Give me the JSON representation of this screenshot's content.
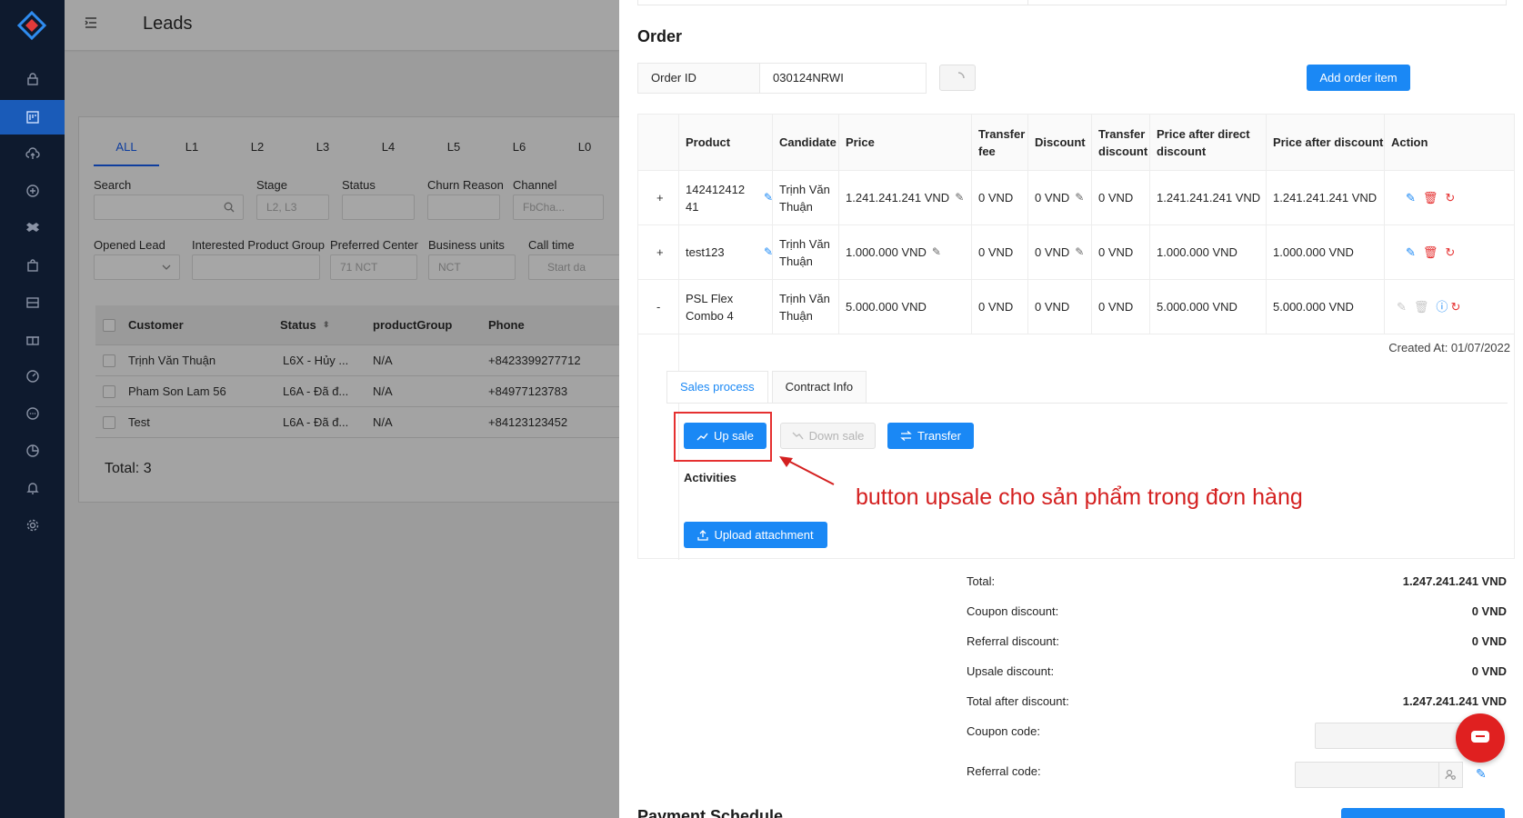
{
  "app": {
    "page_title": "Leads",
    "nav_icons": [
      "lock-icon",
      "board-icon",
      "upload-cloud-icon",
      "plus-circle-icon",
      "dropbox-icon",
      "bag-icon",
      "storage-icon",
      "gift-icon",
      "dashboard-icon",
      "chat-icon",
      "pie-chart-icon",
      "bell-icon",
      "gear-icon"
    ],
    "nav_active_index": 1
  },
  "leads": {
    "tabs": [
      "ALL",
      "L1",
      "L2",
      "L3",
      "L4",
      "L5",
      "L6",
      "L0"
    ],
    "active_tab": "ALL",
    "filters_row1": [
      {
        "label": "Search",
        "placeholder": ""
      },
      {
        "label": "Stage",
        "placeholder": "L2, L3"
      },
      {
        "label": "Status",
        "placeholder": ""
      },
      {
        "label": "Churn Reason",
        "placeholder": ""
      },
      {
        "label": "Channel",
        "placeholder": "FbCha..."
      }
    ],
    "filters_row2": [
      {
        "label": "Opened Lead",
        "placeholder": ""
      },
      {
        "label": "Interested Product Group",
        "placeholder": ""
      },
      {
        "label": "Preferred Center",
        "placeholder": "71 NCT"
      },
      {
        "label": "Business units",
        "placeholder": "NCT"
      },
      {
        "label": "Call time",
        "placeholder": "Start da"
      }
    ],
    "columns": [
      "Customer",
      "Status",
      "productGroup",
      "Phone"
    ],
    "rows": [
      {
        "customer": "Trịnh Văn Thuận",
        "status": "L6X - Hủy ...",
        "group": "N/A",
        "phone": "+8423399277712"
      },
      {
        "customer": "Pham Son Lam 56",
        "status": "L6A - Đã đ...",
        "group": "N/A",
        "phone": "+84977123783"
      },
      {
        "customer": "Test",
        "status": "L6A - Đã đ...",
        "group": "N/A",
        "phone": "+84123123452"
      }
    ],
    "total": "Total: 3"
  },
  "order": {
    "title": "Order",
    "order_id_label": "Order ID",
    "order_id_value": "030124NRWI",
    "add_button": "Add order item",
    "columns": [
      "Product",
      "Candidate",
      "Price",
      "Transfer fee",
      "Discount",
      "Transfer discount",
      "Price after direct discount",
      "Price after discount",
      "Action"
    ],
    "items": [
      {
        "expand": "+",
        "product": "142412412 41",
        "candidate": "Trịnh Văn Thuận",
        "price": "1.241.241.241 VND",
        "transfer_fee": "0 VND",
        "discount": "0 VND",
        "transfer_discount": "0 VND",
        "after_direct": "1.241.241.241 VND",
        "after_discount": "1.241.241.241 VND"
      },
      {
        "expand": "+",
        "product": "test123",
        "candidate": "Trịnh Văn Thuận",
        "price": "1.000.000 VND",
        "transfer_fee": "0 VND",
        "discount": "0 VND",
        "transfer_discount": "0 VND",
        "after_direct": "1.000.000 VND",
        "after_discount": "1.000.000 VND"
      },
      {
        "expand": "-",
        "product": "PSL Flex Combo 4",
        "candidate": "Trịnh Văn Thuận",
        "price": "5.000.000 VND",
        "transfer_fee": "0 VND",
        "discount": "0 VND",
        "transfer_discount": "0 VND",
        "after_direct": "5.000.000 VND",
        "after_discount": "5.000.000 VND"
      }
    ],
    "created_at": "Created At: 01/07/2022",
    "sub_tabs": [
      "Sales process",
      "Contract Info"
    ],
    "up_sale": "Up sale",
    "down_sale": "Down sale",
    "transfer": "Transfer",
    "activities": "Activities",
    "upload": "Upload attachment",
    "annotation": "button upsale cho sản phẩm trong đơn hàng"
  },
  "summary": {
    "total_label": "Total:",
    "total": "1.247.241.241 VND",
    "coupon_discount_label": "Coupon discount:",
    "coupon_discount": "0 VND",
    "referral_discount_label": "Referral discount:",
    "referral_discount": "0 VND",
    "upsale_discount_label": "Upsale discount:",
    "upsale_discount": "0 VND",
    "after_discount_label": "Total after discount:",
    "after_discount": "1.247.241.241 VND",
    "coupon_code_label": "Coupon code:",
    "referral_code_label": "Referral code:"
  },
  "payment": {
    "title": "Payment Schedule"
  }
}
